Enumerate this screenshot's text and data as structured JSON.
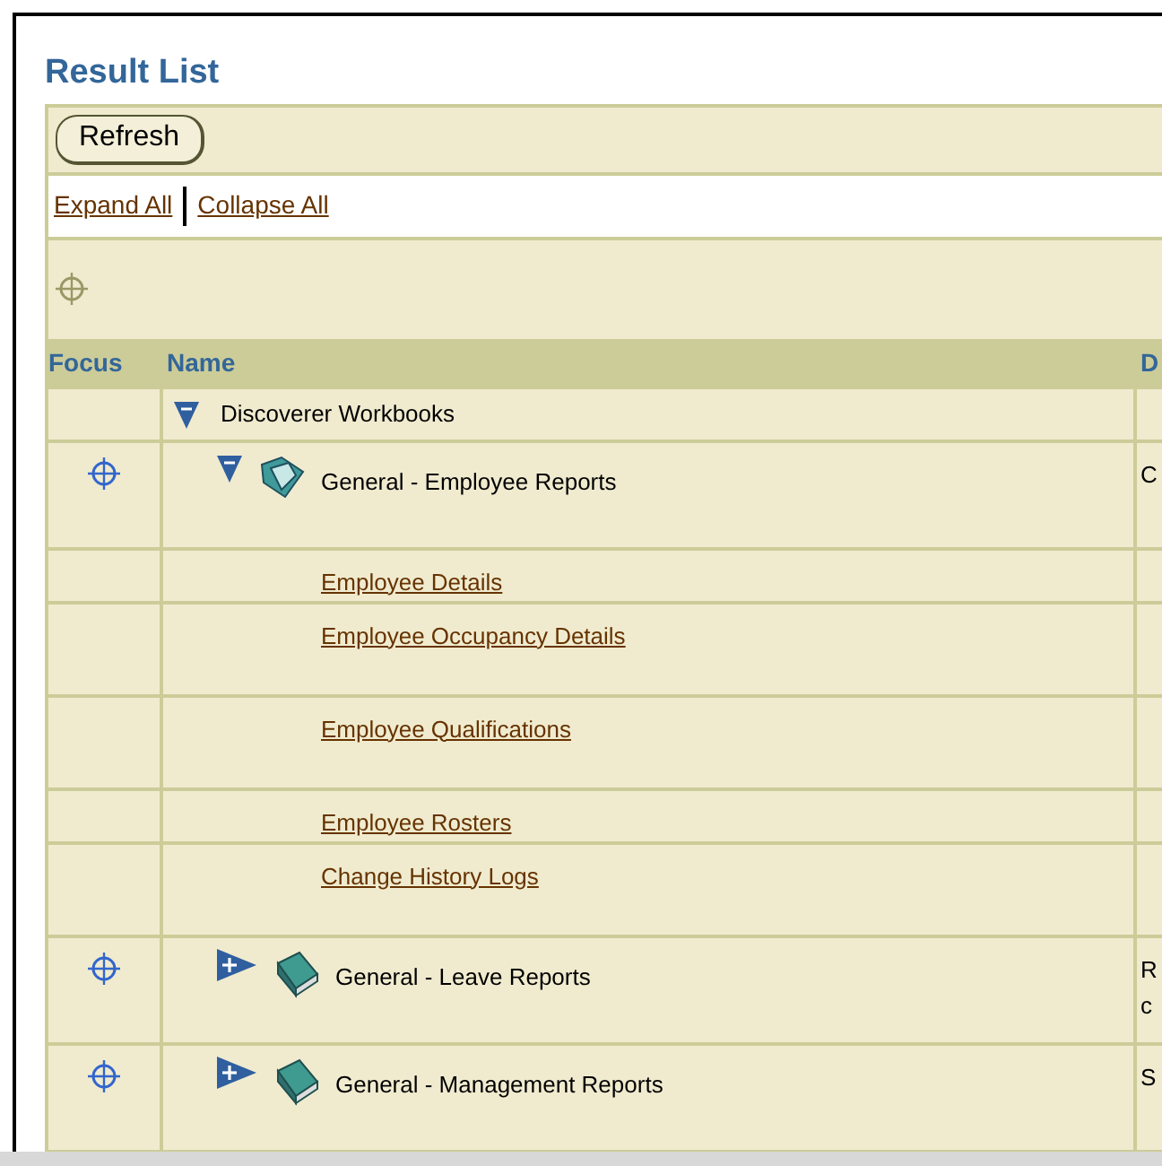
{
  "title": "Result List",
  "refresh_button": "Refresh",
  "links": [
    "Expand All",
    "Collapse All"
  ],
  "columns": [
    "Focus",
    "Name",
    "D"
  ],
  "tree": [
    {
      "name": "Discoverer Workbooks",
      "expanded": true,
      "focus": false,
      "children": [
        {
          "name": "General - Employee Reports",
          "expanded": true,
          "focus": true,
          "description": [
            "C"
          ],
          "children": [
            {
              "name": "Employee Details",
              "tall": false
            },
            {
              "name": "Employee Occupancy Details",
              "tall": true
            },
            {
              "name": "Employee Qualifications",
              "tall": true
            },
            {
              "name": "Employee Rosters",
              "tall": false
            },
            {
              "name": "Change History Logs",
              "tall": true
            }
          ]
        },
        {
          "name": "General - Leave Reports",
          "expanded": false,
          "focus": true,
          "description": [
            "R",
            "c"
          ]
        },
        {
          "name": "General - Management Reports",
          "expanded": false,
          "focus": true,
          "description": [
            "S"
          ]
        }
      ]
    }
  ]
}
